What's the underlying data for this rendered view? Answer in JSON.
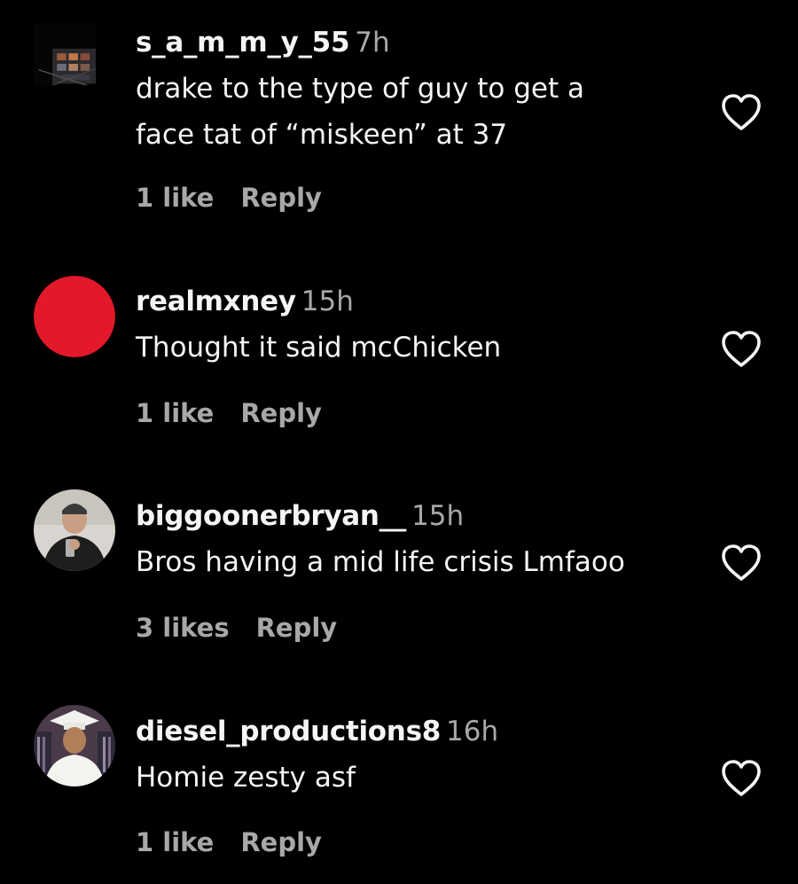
{
  "colors": {
    "background": "#000000",
    "primary_text": "#f5f5f5",
    "secondary_text": "#a8a8a8"
  },
  "comments": [
    {
      "username": "s_a_m_m_y_55",
      "time": "7h",
      "text_lines": [
        "drake to the type of guy to get a",
        "face tat of “miskeen” at 37"
      ],
      "likes": "1 like",
      "reply": "Reply",
      "avatar_icon": "city-building-photo-icon",
      "like_icon": "heart-outline-icon"
    },
    {
      "username": "realmxney",
      "time": "15h",
      "text_lines": [
        "Thought it said mcChicken"
      ],
      "likes": "1 like",
      "reply": "Reply",
      "avatar_icon": "red-circle-avatar",
      "like_icon": "heart-outline-icon"
    },
    {
      "username": "biggoonerbryan__",
      "time": "15h",
      "text_lines": [
        "Bros having a mid life crisis Lmfaoo"
      ],
      "likes": "3 likes",
      "reply": "Reply",
      "avatar_icon": "person-photo-avatar",
      "like_icon": "heart-outline-icon"
    },
    {
      "username": "diesel_productions8",
      "time": "16h",
      "text_lines": [
        "Homie zesty asf"
      ],
      "likes": "1 like",
      "reply": "Reply",
      "avatar_icon": "graduation-photo-avatar",
      "like_icon": "heart-outline-icon"
    }
  ]
}
